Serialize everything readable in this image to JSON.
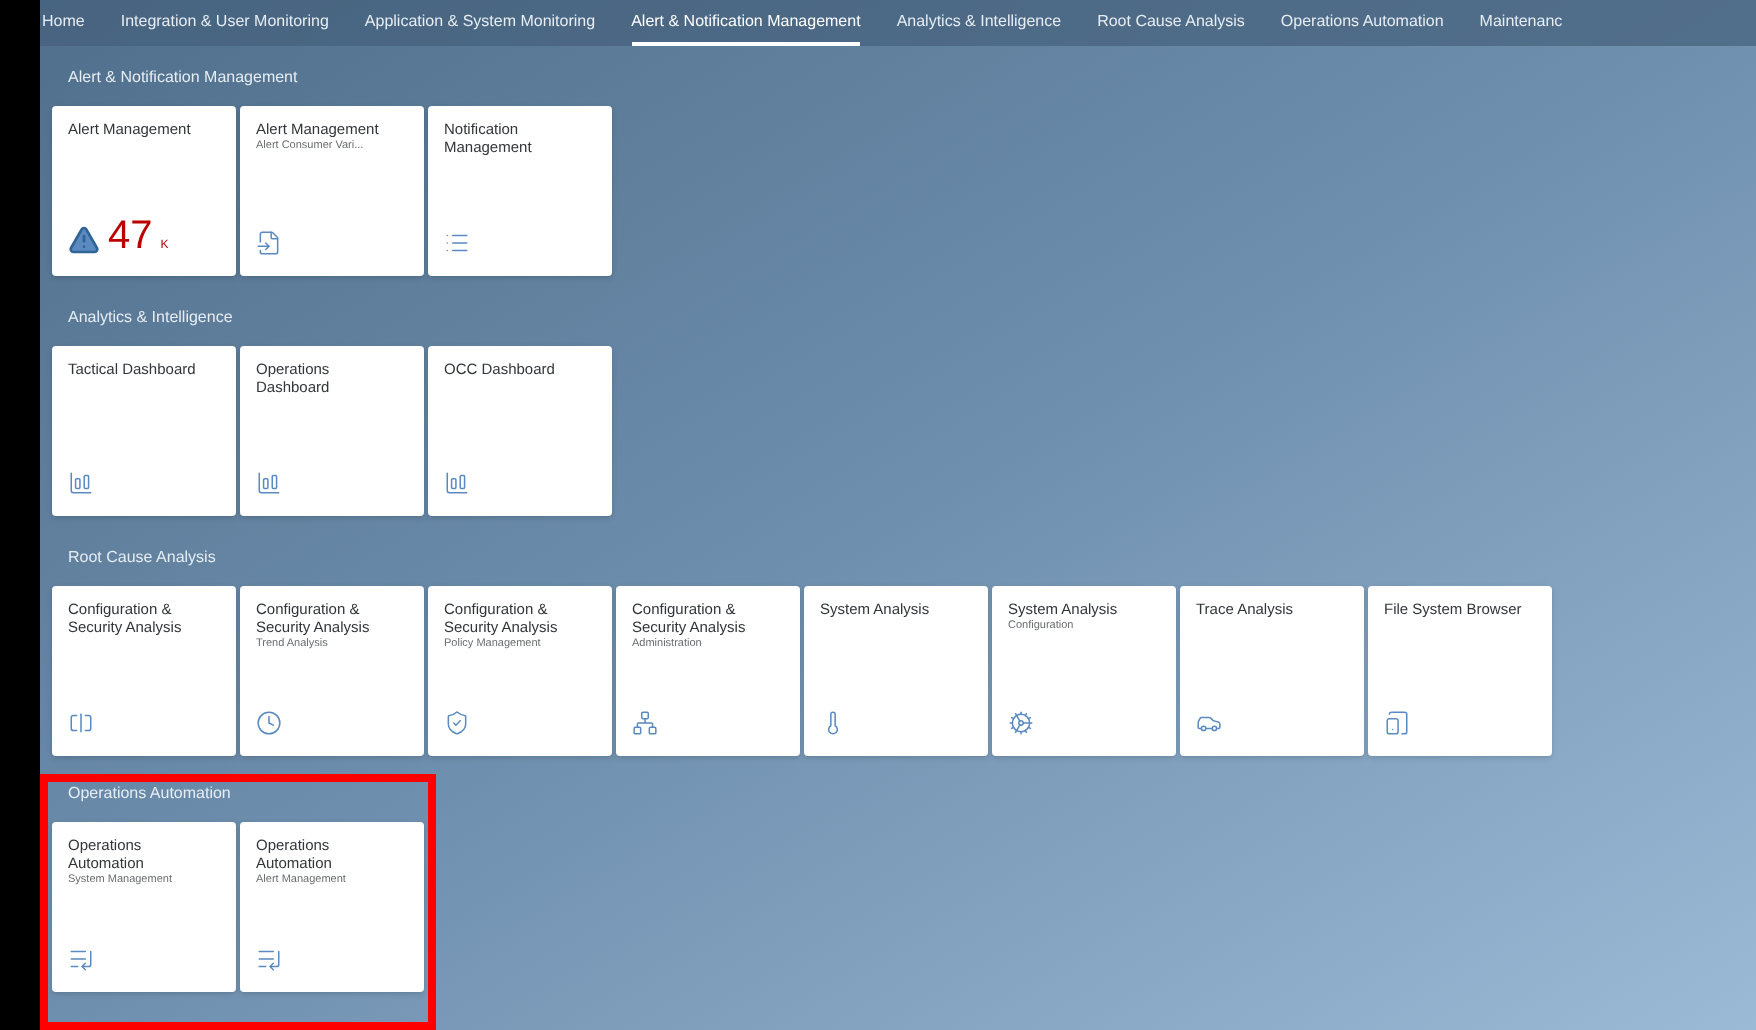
{
  "nav": [
    {
      "label": "Home",
      "selected": false
    },
    {
      "label": "Integration & User Monitoring",
      "selected": false
    },
    {
      "label": "Application & System Monitoring",
      "selected": false
    },
    {
      "label": "Alert & Notification Management",
      "selected": true
    },
    {
      "label": "Analytics & Intelligence",
      "selected": false
    },
    {
      "label": "Root Cause Analysis",
      "selected": false
    },
    {
      "label": "Operations Automation",
      "selected": false
    },
    {
      "label": "Maintenanc",
      "selected": false
    }
  ],
  "sections": [
    {
      "title": "Alert & Notification Management",
      "highlighted": false,
      "tiles": [
        {
          "title": "Alert Management",
          "kind": "kpi",
          "kpi": {
            "value": "47",
            "unit": "K"
          }
        },
        {
          "title": "Alert Management",
          "subtitle": "Alert Consumer Vari...",
          "kind": "import"
        },
        {
          "title": "Notification Management",
          "kind": "list"
        }
      ]
    },
    {
      "title": "Analytics & Intelligence",
      "highlighted": false,
      "tiles": [
        {
          "title": "Tactical Dashboard",
          "kind": "dashboard"
        },
        {
          "title": "Operations Dashboard",
          "kind": "dashboard"
        },
        {
          "title": "OCC Dashboard",
          "kind": "dashboard"
        }
      ]
    },
    {
      "title": "Root Cause Analysis",
      "highlighted": false,
      "tiles": [
        {
          "title": "Configuration & Security Analysis",
          "kind": "compare"
        },
        {
          "title": "Configuration & Security Analysis",
          "subtitle": "Trend Analysis",
          "kind": "trend"
        },
        {
          "title": "Configuration & Security Analysis",
          "subtitle": "Policy Management",
          "kind": "shield"
        },
        {
          "title": "Configuration & Security Analysis",
          "subtitle": "Administration",
          "kind": "hierarchy"
        },
        {
          "title": "System Analysis",
          "kind": "thermometer"
        },
        {
          "title": "System Analysis",
          "subtitle": "Configuration",
          "kind": "gears"
        },
        {
          "title": "Trace Analysis",
          "kind": "car"
        },
        {
          "title": "File System Browser",
          "kind": "device"
        }
      ]
    },
    {
      "title": "Operations Automation",
      "highlighted": true,
      "tiles": [
        {
          "title": "Operations Automation",
          "subtitle": "System Management",
          "kind": "automation"
        },
        {
          "title": "Operations Automation",
          "subtitle": "Alert Management",
          "kind": "automation"
        }
      ]
    }
  ]
}
